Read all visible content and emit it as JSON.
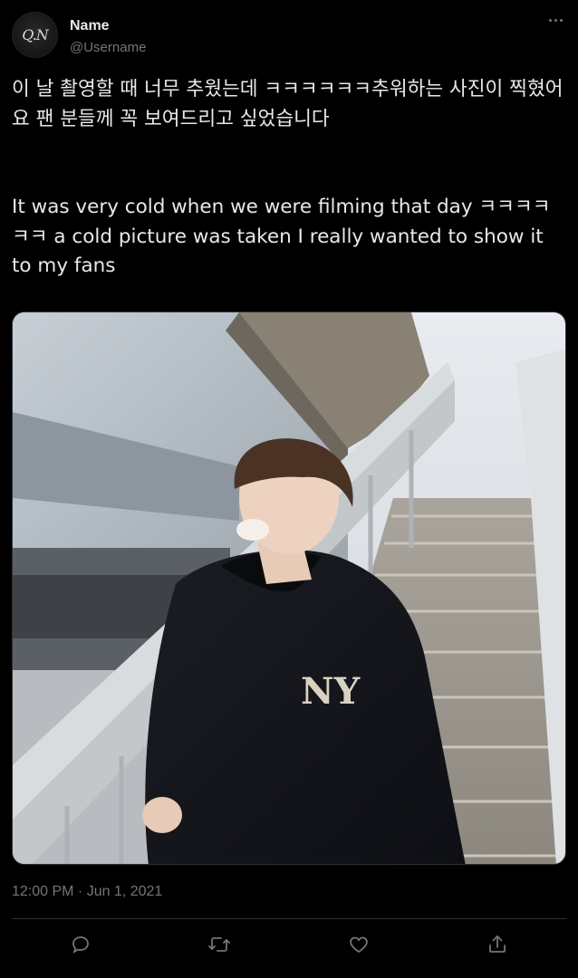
{
  "author": {
    "avatar_text": "Q.N",
    "name": "Name",
    "username": "@Username"
  },
  "tweet": {
    "text_korean": "이 날 촬영할 때 너무 추웠는데 ㅋㅋㅋㅋㅋㅋ추워하는 사진이 찍혔어요 팬 분들께 꼭 보여드리고 싶었습니다",
    "text_english": "It was very cold when we were filming that day ㅋㅋㅋㅋㅋㅋ a cold picture was taken I really wanted to show it to my fans",
    "timestamp": "12:00 PM · Jun 1, 2021",
    "jacket_logo": "NY"
  },
  "actions": [
    {
      "name": "reply",
      "icon": "reply-icon"
    },
    {
      "name": "retweet",
      "icon": "retweet-icon"
    },
    {
      "name": "like",
      "icon": "heart-icon"
    },
    {
      "name": "share",
      "icon": "share-icon"
    }
  ],
  "colors": {
    "background": "#000000",
    "text": "#e7e9ea",
    "secondary": "#71767b",
    "divider": "#2f3336"
  }
}
